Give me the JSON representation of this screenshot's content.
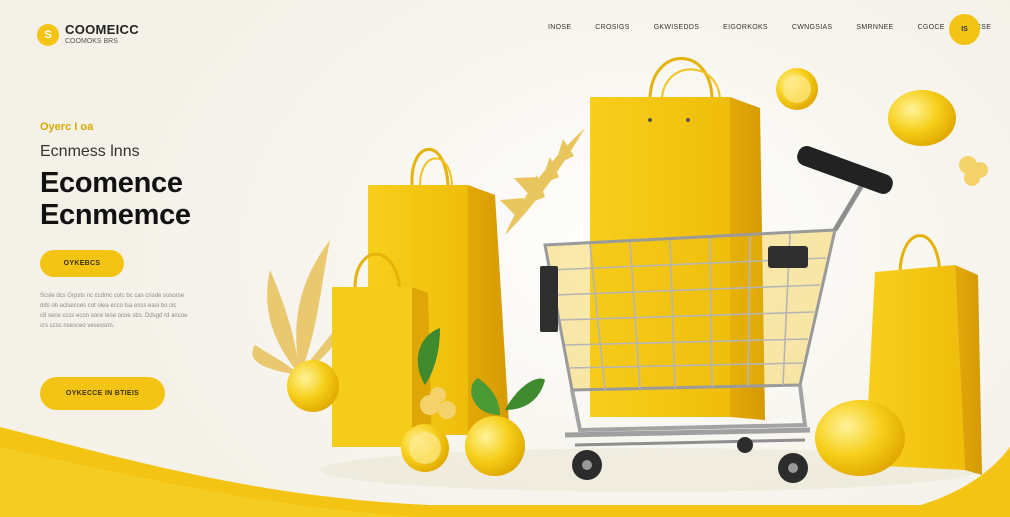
{
  "brand": {
    "logo_mark": "S",
    "name": "COOMEICC",
    "tagline": "COOMOKS BRS"
  },
  "nav": {
    "items": [
      "INOSE",
      "CROSIGS",
      "GKWISEDDS",
      "EIGORKOKS",
      "CWNGSIAS",
      "SMRNNEE",
      "CGOCE",
      "ISCSE"
    ],
    "action_label": "IS"
  },
  "hero": {
    "eyebrow": "Oyerc I oa",
    "subhead": "Ecnmess lnns",
    "headline_line1": "Ecomence",
    "headline_line2": "Ecnmemce",
    "primary_button": "OYKEBCS",
    "body_lines": [
      "Scsle dcs Grpsts nc ccdmc cotc bc cas crisde sosorse",
      "dds ob aclsecses cot olea ecco lsa esss easi bo cic",
      "c8 sece ccss econ soce lese ocoe sbs. Ddsgd rd ancoe",
      "crs ccsc nsesceo vesessnn."
    ],
    "secondary_button": "OYKECCE IN BTIEIS"
  },
  "colors": {
    "accent": "#f3c414",
    "accent_dark": "#e0ad0a",
    "background": "#fbfaf6"
  },
  "icons": [
    "cart-icon",
    "shopping-bag-icon",
    "lemon-icon",
    "leaf-icon"
  ]
}
